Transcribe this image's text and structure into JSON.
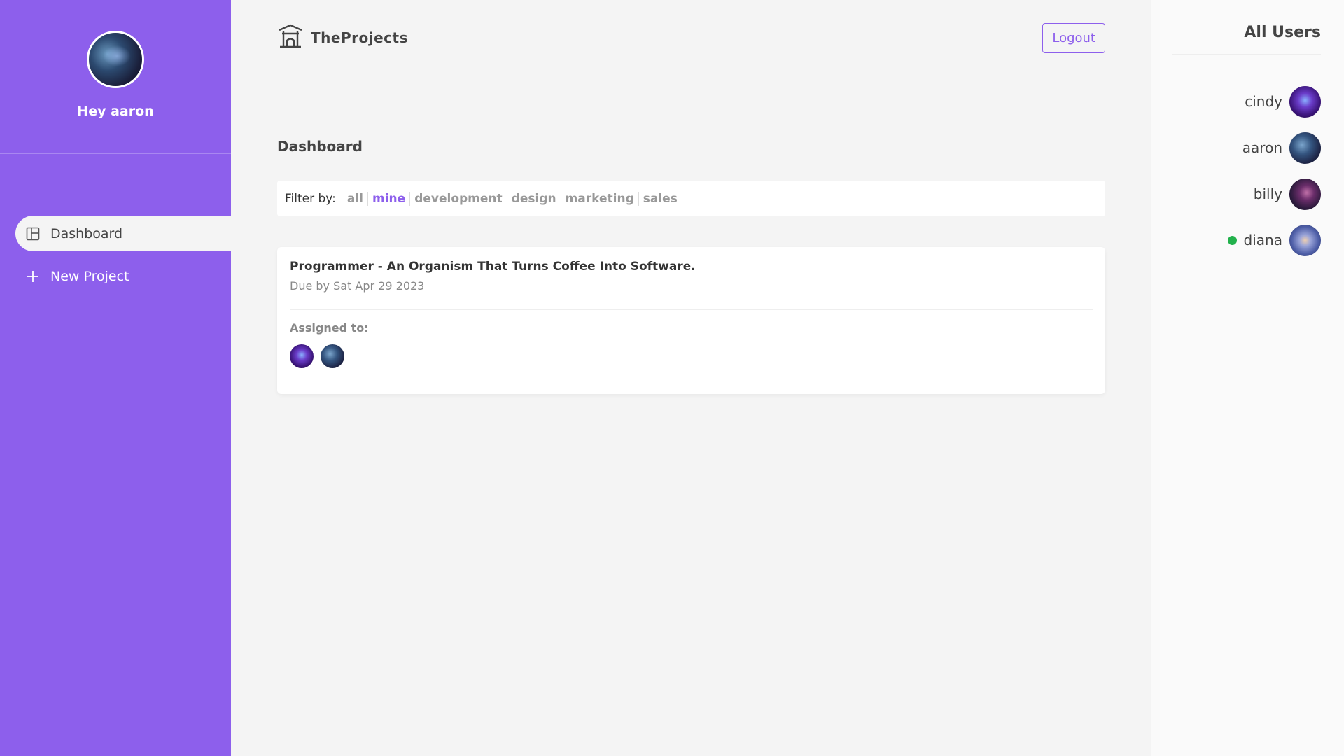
{
  "sidebar": {
    "greeting": "Hey aaron",
    "nav": [
      {
        "label": "Dashboard",
        "icon": "dashboard-icon",
        "active": true
      },
      {
        "label": "New Project",
        "icon": "plus-icon",
        "active": false
      }
    ]
  },
  "header": {
    "brand": "TheProjects",
    "logout_label": "Logout"
  },
  "main": {
    "title": "Dashboard",
    "filter": {
      "label": "Filter by:",
      "options": [
        "all",
        "mine",
        "development",
        "design",
        "marketing",
        "sales"
      ],
      "selected": "mine"
    },
    "projects": [
      {
        "title": "Programmer - An Organism That Turns Coffee Into Software.",
        "due": "Due by Sat Apr 29 2023",
        "assigned_label": "Assigned to:"
      }
    ]
  },
  "users_panel": {
    "title": "All Users",
    "users": [
      {
        "name": "cindy",
        "online": false
      },
      {
        "name": "aaron",
        "online": false
      },
      {
        "name": "billy",
        "online": false
      },
      {
        "name": "diana",
        "online": true
      }
    ]
  },
  "colors": {
    "accent": "#8d5fec",
    "online": "#22b14c"
  }
}
